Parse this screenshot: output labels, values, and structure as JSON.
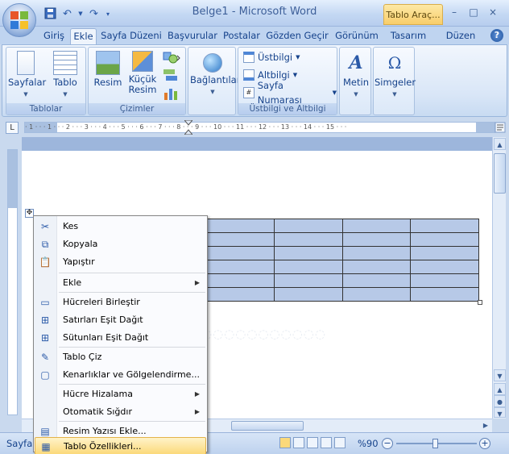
{
  "window": {
    "title": "Belge1 - Microsoft Word",
    "context_tab": "Tablo Araç...",
    "minimize_glyph": "–",
    "maximize_glyph": "□",
    "close_glyph": "×"
  },
  "ribbon_tabs": [
    "Giriş",
    "Ekle",
    "Sayfa Düzeni",
    "Başvurular",
    "Postalar",
    "Gözden Geçir",
    "Görünüm",
    "Tasarım",
    "Düzen"
  ],
  "active_tab": "Ekle",
  "help_glyph": "?",
  "groups": {
    "tables": {
      "label": "Tablolar",
      "pages_button": "Sayfalar",
      "table_button": "Tablo"
    },
    "illustrations": {
      "label": "Çizimler",
      "picture_button": "Resim",
      "clipart_button_line1": "Küçük",
      "clipart_button_line2": "Resim"
    },
    "links": {
      "links_button": "Bağlantılar"
    },
    "header_footer": {
      "label": "Üstbilgi ve Altbilgi",
      "header": "Üstbilgi",
      "footer": "Altbilgi",
      "page_number": "Sayfa Numarası"
    },
    "text": {
      "text_button": "Metin"
    },
    "symbols": {
      "symbols_button": "Simgeler"
    }
  },
  "ruler": {
    "tab_glyph": "L",
    "horizontal_marks": "· 1 · · · 1 · · · 2 · · · 3 · · · 4 · · · 5 · · · 6 · · · 7 · · · 8 · · · 9 · · · 10 · · · 11 · · · 12 · · · 13 · · · 14 · · · 15 · · ·"
  },
  "table": {
    "rows": 6,
    "cols": 4,
    "move_handle_glyph": "✥"
  },
  "context_menu": {
    "items": [
      {
        "label": "Kes",
        "icon": "scissors-icon",
        "glyph": "✂"
      },
      {
        "label": "Kopyala",
        "icon": "copy-icon",
        "glyph": "⧉"
      },
      {
        "label": "Yapıştır",
        "icon": "paste-icon",
        "glyph": "📋"
      },
      {
        "label": "Ekle",
        "icon": "none",
        "glyph": "",
        "submenu": true
      },
      {
        "label": "Hücreleri Birleştir",
        "icon": "merge-cells-icon",
        "glyph": "▭"
      },
      {
        "label": "Satırları Eşit Dağıt",
        "icon": "distribute-rows-icon",
        "glyph": "⊞"
      },
      {
        "label": "Sütunları Eşit Dağıt",
        "icon": "distribute-columns-icon",
        "glyph": "⊞"
      },
      {
        "label": "Tablo Çiz",
        "icon": "draw-table-icon",
        "glyph": "✎"
      },
      {
        "label": "Kenarlıklar ve Gölgelendirme...",
        "icon": "borders-icon",
        "glyph": "▢"
      },
      {
        "label": "Hücre Hizalama",
        "icon": "none",
        "glyph": "",
        "submenu": true
      },
      {
        "label": "Otomatik Sığdır",
        "icon": "none",
        "glyph": "",
        "submenu": true
      },
      {
        "label": "Resim Yazısı Ekle...",
        "icon": "caption-icon",
        "glyph": "▤"
      },
      {
        "label": "Tablo Özellikleri...",
        "icon": "table-properties-icon",
        "glyph": "▦",
        "highlighted": true
      }
    ],
    "submenu_glyph": "▶"
  },
  "status": {
    "label": "Sayfa:",
    "zoom": "%90",
    "zoom_minus": "−",
    "zoom_plus": "+"
  },
  "colors": {
    "ribbon_bg": "#d9e6f7",
    "text_blue": "#15428b",
    "table_fill": "#b7c9e7",
    "highlight": "#fbd97a"
  }
}
